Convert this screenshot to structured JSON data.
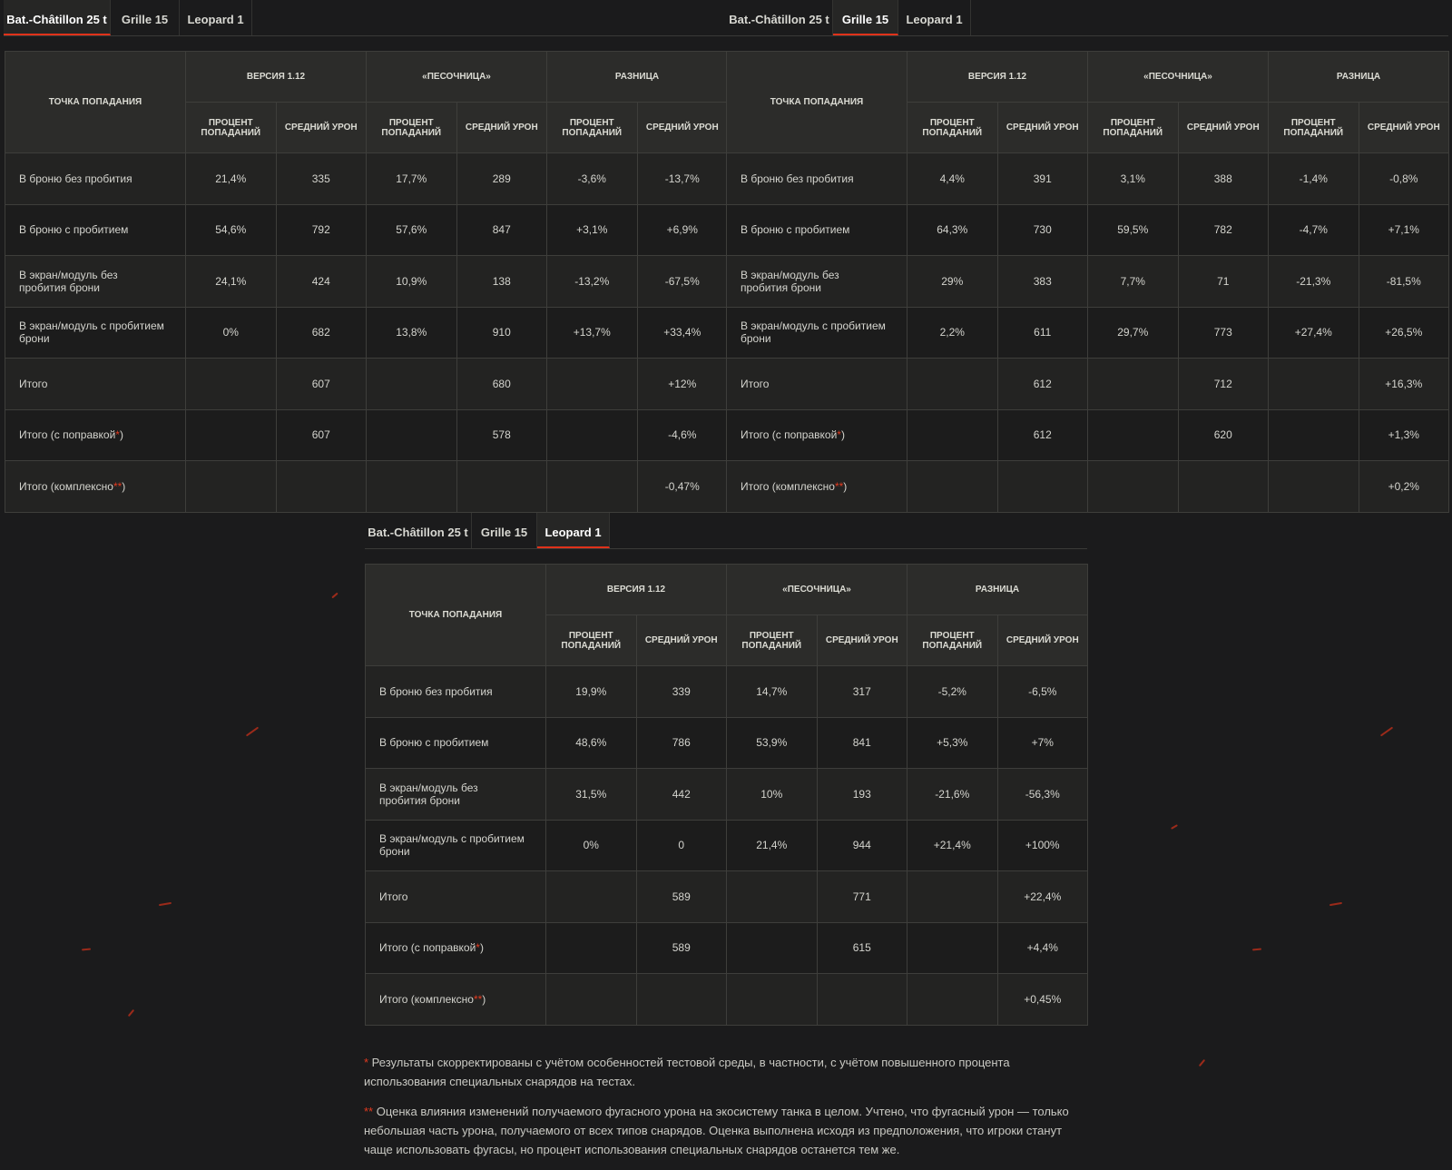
{
  "tabs": [
    "Bat.-Châtillon 25 t",
    "Grille 15",
    "Leopard 1"
  ],
  "headers": {
    "hit_point": "ТОЧКА ПОПАДАНИЯ",
    "version": "ВЕРСИЯ 1.12",
    "sandbox": "«ПЕСОЧНИЦА»",
    "diff": "РАЗНИЦА",
    "hit_pct": "ПРОЦЕНТ ПОПАДАНИЙ",
    "avg_dmg": "СРЕДНИЙ УРОН"
  },
  "row_labels": [
    "В броню без пробития",
    "В броню с пробитием",
    "В экран/модуль без пробития брони",
    "В экран/модуль с пробитием брони",
    "Итого",
    "Итого (с поправкой",
    "Итого (комплексно"
  ],
  "stars": {
    "one": "*",
    "two": "**"
  },
  "close_paren": ")",
  "panels": [
    {
      "active_tab": 0,
      "rows": [
        [
          "21,4%",
          "335",
          "17,7%",
          "289",
          "-3,6%",
          "-13,7%"
        ],
        [
          "54,6%",
          "792",
          "57,6%",
          "847",
          "+3,1%",
          "+6,9%"
        ],
        [
          "24,1%",
          "424",
          "10,9%",
          "138",
          "-13,2%",
          "-67,5%"
        ],
        [
          "0%",
          "682",
          "13,8%",
          "910",
          "+13,7%",
          "+33,4%"
        ],
        [
          "",
          "607",
          "",
          "680",
          "",
          "+12%"
        ],
        [
          "",
          "607",
          "",
          "578",
          "",
          "-4,6%"
        ],
        [
          "",
          "",
          "",
          "",
          "",
          "-0,47%"
        ]
      ]
    },
    {
      "active_tab": 1,
      "rows": [
        [
          "4,4%",
          "391",
          "3,1%",
          "388",
          "-1,4%",
          "-0,8%"
        ],
        [
          "64,3%",
          "730",
          "59,5%",
          "782",
          "-4,7%",
          "+7,1%"
        ],
        [
          "29%",
          "383",
          "7,7%",
          "71",
          "-21,3%",
          "-81,5%"
        ],
        [
          "2,2%",
          "611",
          "29,7%",
          "773",
          "+27,4%",
          "+26,5%"
        ],
        [
          "",
          "612",
          "",
          "712",
          "",
          "+16,3%"
        ],
        [
          "",
          "612",
          "",
          "620",
          "",
          "+1,3%"
        ],
        [
          "",
          "",
          "",
          "",
          "",
          "+0,2%"
        ]
      ]
    },
    {
      "active_tab": 2,
      "rows": [
        [
          "19,9%",
          "339",
          "14,7%",
          "317",
          "-5,2%",
          "-6,5%"
        ],
        [
          "48,6%",
          "786",
          "53,9%",
          "841",
          "+5,3%",
          "+7%"
        ],
        [
          "31,5%",
          "442",
          "10%",
          "193",
          "-21,6%",
          "-56,3%"
        ],
        [
          "0%",
          "0",
          "21,4%",
          "944",
          "+21,4%",
          "+100%"
        ],
        [
          "",
          "589",
          "",
          "771",
          "",
          "+22,4%"
        ],
        [
          "",
          "589",
          "",
          "615",
          "",
          "+4,4%"
        ],
        [
          "",
          "",
          "",
          "",
          "",
          "+0,45%"
        ]
      ]
    }
  ],
  "notes": {
    "n1": " Результаты скорректированы с учётом особенностей тестовой среды, в частности, с учётом повышенного процента использования специальных снарядов на тестах.",
    "n2": " Оценка влияния изменений получаемого фугасного урона на экосистему танка в целом. Учтено, что фугасный урон — только небольшая часть урона, получаемого от всех типов снарядов. Оценка выполнена исходя из предположения, что игроки станут чаще использовать фугасы, но процент использования специальных снарядов останется тем же."
  },
  "accent_color": "#e0321a"
}
